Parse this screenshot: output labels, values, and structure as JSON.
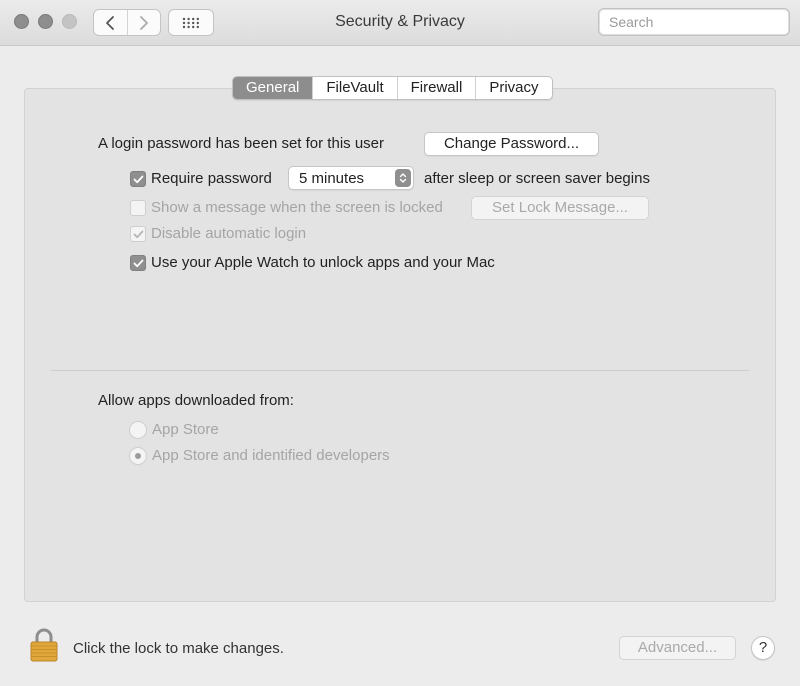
{
  "window": {
    "title": "Security & Privacy",
    "search_placeholder": "Search"
  },
  "tabs": [
    {
      "label": "General",
      "active": true
    },
    {
      "label": "FileVault",
      "active": false
    },
    {
      "label": "Firewall",
      "active": false
    },
    {
      "label": "Privacy",
      "active": false
    }
  ],
  "general": {
    "login_password_text": "A login password has been set for this user",
    "change_password_label": "Change Password...",
    "require_password": {
      "label": "Require password",
      "checked": true
    },
    "require_password_delay": "5 minutes",
    "require_password_suffix": "after sleep or screen saver begins",
    "show_message": {
      "label": "Show a message when the screen is locked",
      "checked": false,
      "enabled": false
    },
    "set_lock_message_label": "Set Lock Message...",
    "disable_auto_login": {
      "label": "Disable automatic login",
      "checked": true,
      "enabled": false
    },
    "apple_watch": {
      "label": "Use your Apple Watch to unlock apps and your Mac",
      "checked": true
    }
  },
  "downloads": {
    "heading": "Allow apps downloaded from:",
    "options": [
      {
        "label": "App Store",
        "selected": false
      },
      {
        "label": "App Store and identified developers",
        "selected": true
      }
    ]
  },
  "footer": {
    "lock_text": "Click the lock to make changes.",
    "advanced_label": "Advanced...",
    "help_label": "?"
  },
  "icons": {
    "lock": "lock-icon",
    "search": "search-icon",
    "back": "chevron-left-icon",
    "forward": "chevron-right-icon",
    "grid": "grid-icon"
  },
  "colors": {
    "active_tab": "#8d8d8d",
    "checkbox_checked": "#8f8f8f",
    "lock_gold": "#e0a83a"
  }
}
